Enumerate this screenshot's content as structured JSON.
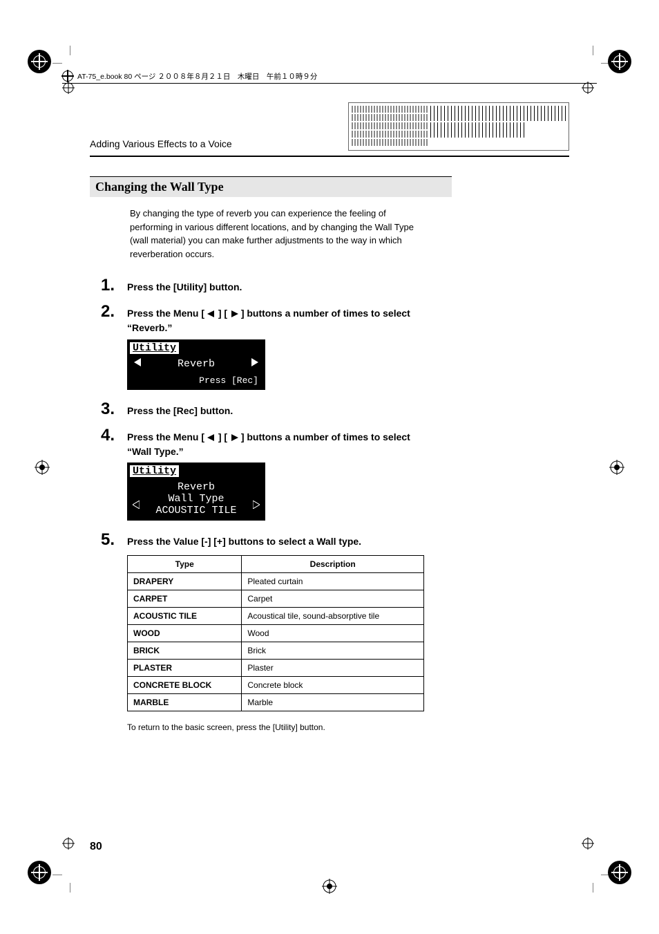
{
  "header_meta": "AT-75_e.book 80 ページ ２００８年８月２１日　木曜日　午前１０時９分",
  "running_head": "Adding Various Effects to a Voice",
  "section_title": "Changing the Wall Type",
  "intro": "By changing the type of reverb you can experience the feeling of performing in various different locations, and by changing the Wall Type (wall material) you can make further adjustments to the way in which reverberation occurs.",
  "steps": {
    "s1": "Press the [Utility] button.",
    "s2a": "Press the Menu [",
    "s2b": "] [",
    "s2c": "] buttons a number of times to select “Reverb.”",
    "s3": "Press the [Rec] button.",
    "s4a": "Press the Menu [",
    "s4b": "] [",
    "s4c": "] buttons a number of times to select “Wall Type.”",
    "s5": "Press the Value [-] [+] buttons to select a Wall type."
  },
  "lcd1": {
    "title": "Utility",
    "value": "Reverb",
    "hint": "Press [Rec]"
  },
  "lcd2": {
    "title": "Utility",
    "l1": "Reverb",
    "l2": "Wall Type",
    "l3": "ACOUSTIC TILE"
  },
  "table": {
    "h1": "Type",
    "h2": "Description",
    "rows": [
      {
        "t": "DRAPERY",
        "d": "Pleated curtain"
      },
      {
        "t": "CARPET",
        "d": "Carpet"
      },
      {
        "t": "ACOUSTIC TILE",
        "d": "Acoustical tile, sound-absorptive tile"
      },
      {
        "t": "WOOD",
        "d": "Wood"
      },
      {
        "t": "BRICK",
        "d": "Brick"
      },
      {
        "t": "PLASTER",
        "d": "Plaster"
      },
      {
        "t": "CONCRETE BLOCK",
        "d": "Concrete block"
      },
      {
        "t": "MARBLE",
        "d": "Marble"
      }
    ]
  },
  "return_note": "To return to the basic screen, press the [Utility] button.",
  "page_number": "80"
}
